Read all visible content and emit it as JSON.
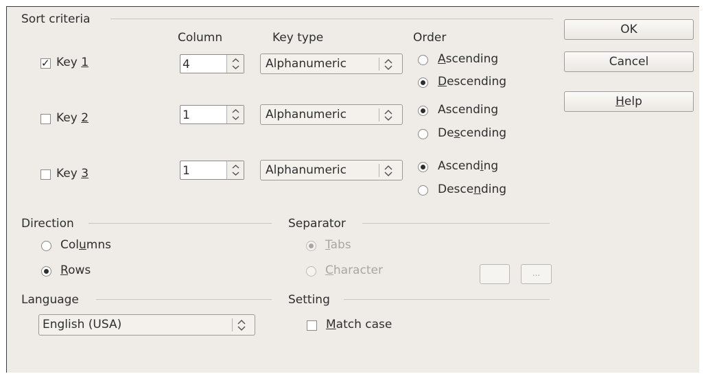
{
  "sort_criteria": {
    "title": "Sort criteria",
    "col_header": "Column",
    "keytype_header": "Key type",
    "order_header": "Order",
    "keys": [
      {
        "label_pre": "Key ",
        "label_u": "1",
        "checked": true,
        "column": "4",
        "key_type": "Alphanumeric",
        "asc_pre": "",
        "asc_u": "A",
        "asc_post": "scending",
        "desc_pre": "",
        "desc_u": "D",
        "desc_post": "escending",
        "selected": "descending"
      },
      {
        "label_pre": "Key ",
        "label_u": "2",
        "checked": false,
        "column": "1",
        "key_type": "Alphanumeric",
        "asc_pre": "Ascendin",
        "asc_u": "g",
        "asc_post": "",
        "desc_pre": "De",
        "desc_u": "s",
        "desc_post": "cending",
        "selected": "ascending"
      },
      {
        "label_pre": "Key ",
        "label_u": "3",
        "checked": false,
        "column": "1",
        "key_type": "Alphanumeric",
        "asc_pre": "Ascend",
        "asc_u": "i",
        "asc_post": "ng",
        "desc_pre": "Desce",
        "desc_u": "n",
        "desc_post": "ding",
        "selected": "ascending"
      }
    ]
  },
  "direction": {
    "title": "Direction",
    "columns_pre": "Col",
    "columns_u": "u",
    "columns_post": "mns",
    "rows_pre": "",
    "rows_u": "R",
    "rows_post": "ows",
    "selected": "rows"
  },
  "separator": {
    "title": "Separator",
    "tabs_pre": "",
    "tabs_u": "T",
    "tabs_post": "abs",
    "char_pre": "",
    "char_u": "C",
    "char_post": "haracter",
    "char_button": "...",
    "selected": "tabs"
  },
  "language": {
    "title": "Language",
    "value": "English (USA)"
  },
  "setting": {
    "title": "Setting",
    "match_pre": "",
    "match_u": "M",
    "match_post": "atch case",
    "match_checked": false
  },
  "buttons": {
    "ok": "OK",
    "cancel": "Cancel",
    "help_pre": "",
    "help_u": "H",
    "help_post": "elp"
  },
  "icons": {
    "checkmark": "check-icon",
    "spin_arrows": "up-down-arrows-icon"
  }
}
